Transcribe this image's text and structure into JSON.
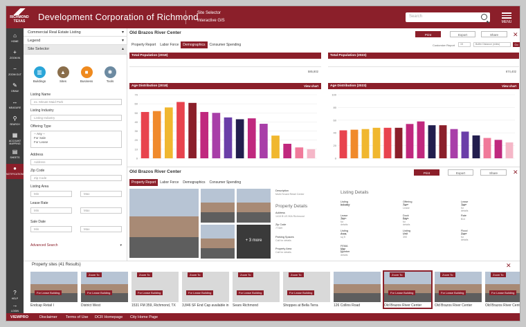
{
  "header": {
    "logo_line1": "RICHMOND",
    "logo_line2": "TEXAS",
    "title": "Development Corporation of Richmond",
    "nav1": "Site Selector",
    "nav2": "Interactive GIS",
    "search_placeholder": "Search",
    "menu_label": "MENU"
  },
  "rail": {
    "items": [
      "HOME",
      "ZOOM IN",
      "ZOOM OUT",
      "DRAW",
      "MEASURE",
      "SEARCH",
      "ACCOUNT MAPPING",
      "SHEETS",
      "NOTIFICATIONS"
    ],
    "bottom": [
      "HELP",
      "LOGIN"
    ]
  },
  "left": {
    "listing_dropdown": "Commercial Real Estate Listing",
    "legend": "Legend",
    "site_selector": "Site Selector",
    "categories": [
      "Buildings",
      "Sites",
      "Business",
      "Tools"
    ],
    "listing_name_label": "Listing Name",
    "listing_name_placeholder": "ex. Minute Maid Park",
    "listing_industry_label": "Listing Industry",
    "listing_industry_placeholder": "Listing Industry",
    "offering_type_label": "Offering Type",
    "offering_options": [
      "-- Any --",
      "For Sale",
      "For Lease"
    ],
    "address_label": "Address",
    "address_placeholder": "Address",
    "zip_label": "Zip Code",
    "zip_placeholder": "Zip Code",
    "listing_area_label": "Listing Area",
    "lease_rate_label": "Lease Rate",
    "sale_date_label": "Sale Date",
    "min": "Min",
    "max": "Max",
    "advanced_search": "Advanced Search"
  },
  "report1": {
    "title": "Old Brazos River Center",
    "print": "Print",
    "export": "Export",
    "share": "Share",
    "tabs": [
      "Property Report",
      "Labor Force",
      "Demographics",
      "Consumer Spending"
    ],
    "active_tab": 2,
    "customize": "Customize Report",
    "select1": "15",
    "select2": "Buffer Distance (miles)",
    "go": "Go",
    "pop2018_label": "Total Population (2018)",
    "pop2018_value": "585,802",
    "pop2023_label": "Total Population (2023)",
    "pop2023_value": "674,402",
    "age2018_label": "Age Distribution (2018)",
    "age2023_label": "Age Distribution (2023)",
    "view_chart": "View chart"
  },
  "chart_data": [
    {
      "type": "bar",
      "title": "Age Distribution (2018)",
      "values": [
        51,
        52,
        56,
        62,
        61,
        51,
        50,
        45,
        43,
        44,
        38,
        25,
        16,
        12,
        10
      ],
      "ylim": [
        0,
        70
      ],
      "yticks": [
        0,
        10,
        20,
        30,
        40,
        50,
        60,
        70
      ],
      "colors": [
        "#e8434e",
        "#f08a2c",
        "#f0b72f",
        "#e8434e",
        "#8b1f2a",
        "#c0287e",
        "#a83ea8",
        "#6a3ea8",
        "#221e4e",
        "#c0287e",
        "#a83ea8",
        "#f0b72f",
        "#c0287e",
        "#f07a9a",
        "#f5b7c8"
      ]
    },
    {
      "type": "bar",
      "title": "Age Distribution (2023)",
      "values": [
        44,
        45,
        46,
        48,
        48,
        48,
        54,
        58,
        52,
        52,
        46,
        42,
        36,
        32,
        29,
        25
      ],
      "ylim": [
        0,
        100
      ],
      "yticks": [
        0,
        20,
        40,
        60,
        80,
        100
      ],
      "colors": [
        "#e8434e",
        "#f08a2c",
        "#f0b72f",
        "#f0b72f",
        "#e8434e",
        "#8b1f2a",
        "#c0287e",
        "#c0287e",
        "#221e4e",
        "#8b1f2a",
        "#a83ea8",
        "#6a3ea8",
        "#221e4e",
        "#f07a9a",
        "#c0287e",
        "#f5b7c8"
      ]
    }
  ],
  "report2": {
    "title": "Old Brazos River Center",
    "print": "Print",
    "export": "Export",
    "share": "Share",
    "tabs": [
      "Property Report",
      "Labor Force",
      "Demographics",
      "Consumer Spending"
    ],
    "active_tab": 0,
    "more_photos": "+ 3 more",
    "description_label": "Description",
    "description_value": "Multi-Tenant Retail Center",
    "property_details": "Property Details",
    "address_label": "Address",
    "address_value": "1415 B US 90A Richmond",
    "zip_label": "Zip Code",
    "zip_value": "77469",
    "parking_label": "Parking Spaces",
    "parking_value": "Call for details",
    "area_label": "Property Area",
    "area_value": "Call for details",
    "listing_details": "Listing Details",
    "details": [
      {
        "label": "Listing Industry",
        "value": "Building"
      },
      {
        "label": "Offering Type",
        "value": "For Lease"
      },
      {
        "label": "Lease Type",
        "value": "Call for details"
      },
      {
        "label": "Lease Term",
        "value": "Call for details"
      },
      {
        "label": "Dock Bays",
        "value": "Call for details"
      },
      {
        "label": "Rate",
        "value": "$14"
      },
      {
        "label": "Listing Area",
        "value": "2,400 sq ft"
      },
      {
        "label": "Listing Unit",
        "value": "STE 390"
      },
      {
        "label": "Flood Zone",
        "value": "Call for details"
      },
      {
        "label": "FEMA Map Number",
        "value": "Call for details"
      }
    ]
  },
  "results": {
    "title": "Property sites (41 Results)",
    "zoom_to": "Zoom To",
    "for_lease": "For Lease Building",
    "cards": [
      {
        "caption": "Endcap Retail I",
        "zoom": false,
        "lease": true,
        "photo": true
      },
      {
        "caption": "District West",
        "zoom": true,
        "lease": true,
        "photo": true
      },
      {
        "caption": "1531 FM 359, Richmond, TX",
        "zoom": true,
        "lease": true,
        "photo": false
      },
      {
        "caption": "3,846 SF End Cap available in",
        "zoom": true,
        "lease": true,
        "photo": false
      },
      {
        "caption": "Sears Richmond",
        "zoom": true,
        "lease": true,
        "photo": false
      },
      {
        "caption": "Shoppes at Bella Terra",
        "zoom": true,
        "lease": true,
        "photo": false
      },
      {
        "caption": "126 Collins Road",
        "zoom": false,
        "lease": false,
        "photo": true
      },
      {
        "caption": "Old Brazos River Center",
        "zoom": true,
        "lease": true,
        "photo": true
      },
      {
        "caption": "Old Brazos River Center",
        "zoom": true,
        "lease": true,
        "photo": true
      },
      {
        "caption": "Old Brazos River Center",
        "zoom": true,
        "lease": true,
        "photo": true
      }
    ]
  },
  "footer": {
    "brand": "VIEWPRO",
    "links": [
      "Disclaimer",
      "Terms of Use",
      "DCR Homepage",
      "City Home Page"
    ]
  }
}
